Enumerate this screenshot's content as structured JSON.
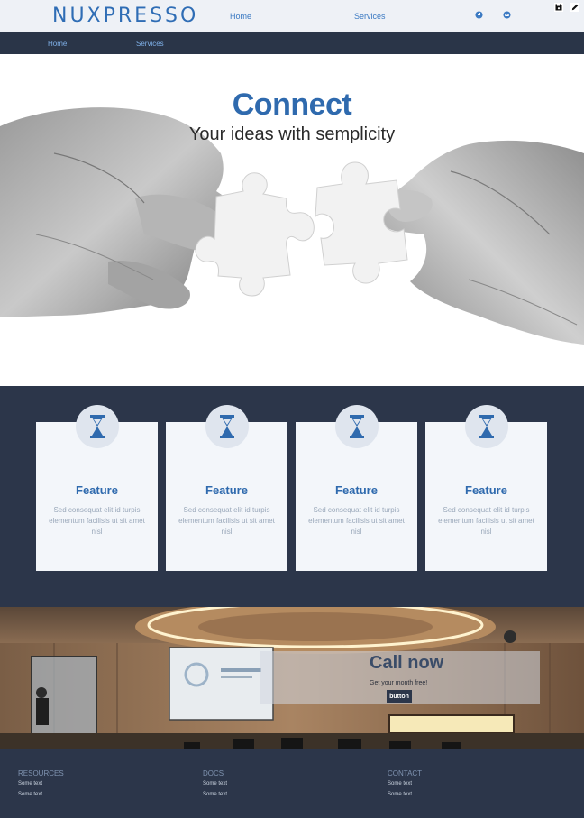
{
  "header": {
    "logo": "NUXPRESSO",
    "links": [
      "Home",
      "Services"
    ],
    "social_icons": [
      "facebook-icon",
      "mail-icon"
    ],
    "tool_icons": [
      "save-icon",
      "edit-icon"
    ]
  },
  "nav": {
    "links": [
      "Home",
      "Services"
    ]
  },
  "hero": {
    "title": "Connect",
    "subtitle": "Your ideas with semplicity"
  },
  "features": {
    "cards": [
      {
        "icon": "hourglass-icon",
        "title": "Feature",
        "text": "Sed consequat elit id turpis elementum facilisis ut sit amet nisl"
      },
      {
        "icon": "hourglass-icon",
        "title": "Feature",
        "text": "Sed consequat elit id turpis elementum facilisis ut sit amet nisl"
      },
      {
        "icon": "hourglass-icon",
        "title": "Feature",
        "text": "Sed consequat elit id turpis elementum facilisis ut sit amet nisl"
      },
      {
        "icon": "hourglass-icon",
        "title": "Feature",
        "text": "Sed consequat elit id turpis elementum facilisis ut sit amet nisl"
      }
    ]
  },
  "cta": {
    "title": "Call now",
    "subtitle": "Get your month free!",
    "button": "button"
  },
  "footer": {
    "columns": [
      {
        "heading": "RESOURCES",
        "links": [
          "Some text",
          "Some text"
        ]
      },
      {
        "heading": "DOCS",
        "links": [
          "Some text",
          "Some text"
        ]
      },
      {
        "heading": "CONTACT",
        "links": [
          "Some text",
          "Some text"
        ]
      }
    ]
  },
  "colors": {
    "brand_blue": "#2f6db5",
    "navy": "#2c364a",
    "card_bg": "#f3f6fa"
  }
}
